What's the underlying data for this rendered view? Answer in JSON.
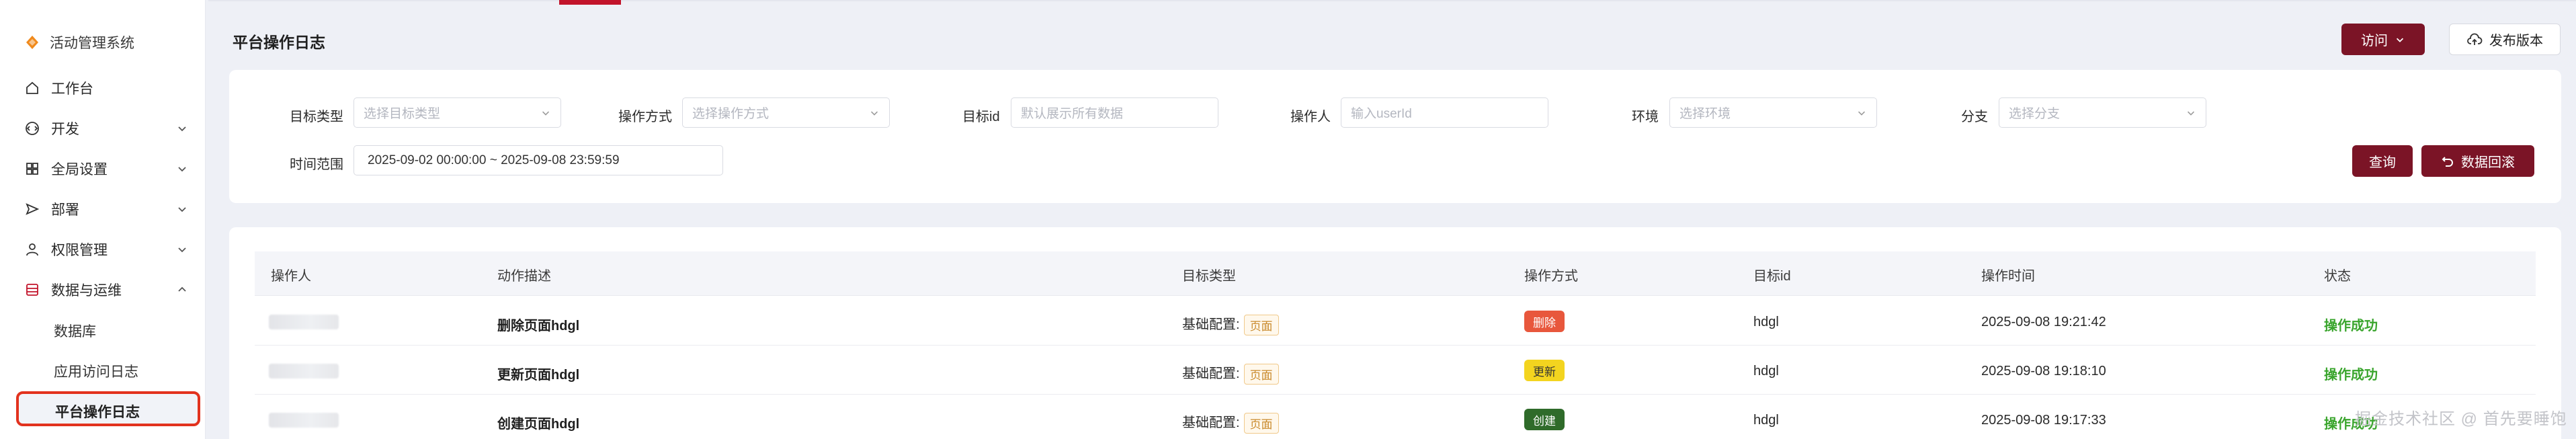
{
  "sidebar": {
    "brand": "活动管理系统",
    "items": [
      {
        "label": "工作台",
        "icon": "home-icon"
      },
      {
        "label": "开发",
        "icon": "code-icon"
      },
      {
        "label": "全局设置",
        "icon": "grid-icon"
      },
      {
        "label": "部署",
        "icon": "send-icon"
      },
      {
        "label": "权限管理",
        "icon": "user-icon"
      },
      {
        "label": "数据与运维",
        "icon": "database-icon"
      }
    ],
    "sub_items": [
      "数据库",
      "应用访问日志",
      "平台操作日志"
    ]
  },
  "header": {
    "title": "平台操作日志",
    "visit_label": "访问",
    "publish_label": "发布版本"
  },
  "filters": {
    "target_type": {
      "label": "目标类型",
      "placeholder": "选择目标类型"
    },
    "operation_type": {
      "label": "操作方式",
      "placeholder": "选择操作方式"
    },
    "target_id": {
      "label": "目标id",
      "placeholder": "默认展示所有数据"
    },
    "operator": {
      "label": "操作人",
      "placeholder": "输入userId"
    },
    "env": {
      "label": "环境",
      "placeholder": "选择环境"
    },
    "branch": {
      "label": "分支",
      "placeholder": "选择分支"
    },
    "time_range": {
      "label": "时间范围",
      "value": "2025-09-02 00:00:00 ~ 2025-09-08 23:59:59"
    },
    "query_label": "查询",
    "rollback_label": "数据回滚"
  },
  "table": {
    "columns": [
      "操作人",
      "动作描述",
      "目标类型",
      "操作方式",
      "目标id",
      "操作时间",
      "状态"
    ],
    "rows": [
      {
        "desc": "删除页面hdgl",
        "target_prefix": "基础配置:",
        "target_tag": "页面",
        "action": "删除",
        "action_color": "#e8573c",
        "target_id": "hdgl",
        "time": "2025-09-08 19:21:42",
        "status": "操作成功"
      },
      {
        "desc": "更新页面hdgl",
        "target_prefix": "基础配置:",
        "target_tag": "页面",
        "action": "更新",
        "action_color": "#f3d41f",
        "target_id": "hdgl",
        "time": "2025-09-08 19:18:10",
        "status": "操作成功"
      },
      {
        "desc": "创建页面hdgl",
        "target_prefix": "基础配置:",
        "target_tag": "页面",
        "action": "创建",
        "action_color": "#2f6b2a",
        "target_id": "hdgl",
        "time": "2025-09-08 19:17:33",
        "status": "操作成功"
      }
    ]
  },
  "watermark": "掘金技术社区 @ 首先要睡饱",
  "colors": {
    "primary": "#7b1426",
    "accent": "#c2142b",
    "success": "#3aa52d",
    "highlight_border": "#e2321e"
  }
}
